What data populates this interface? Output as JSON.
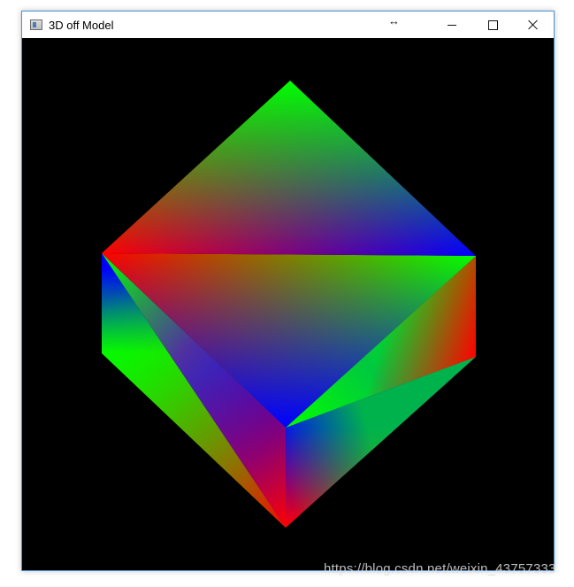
{
  "window": {
    "title": "3D off Model",
    "resize_glyph": "↔"
  },
  "icons": {
    "app": "app-window-icon",
    "minimize": "minimize-icon",
    "maximize": "maximize-icon",
    "close": "close-icon"
  },
  "colors": {
    "background": "#000000",
    "vertex_red": "#ff0000",
    "vertex_green": "#00ff00",
    "vertex_blue": "#0000ff"
  },
  "watermark": "https://blog.csdn.net/weixin_43757333"
}
